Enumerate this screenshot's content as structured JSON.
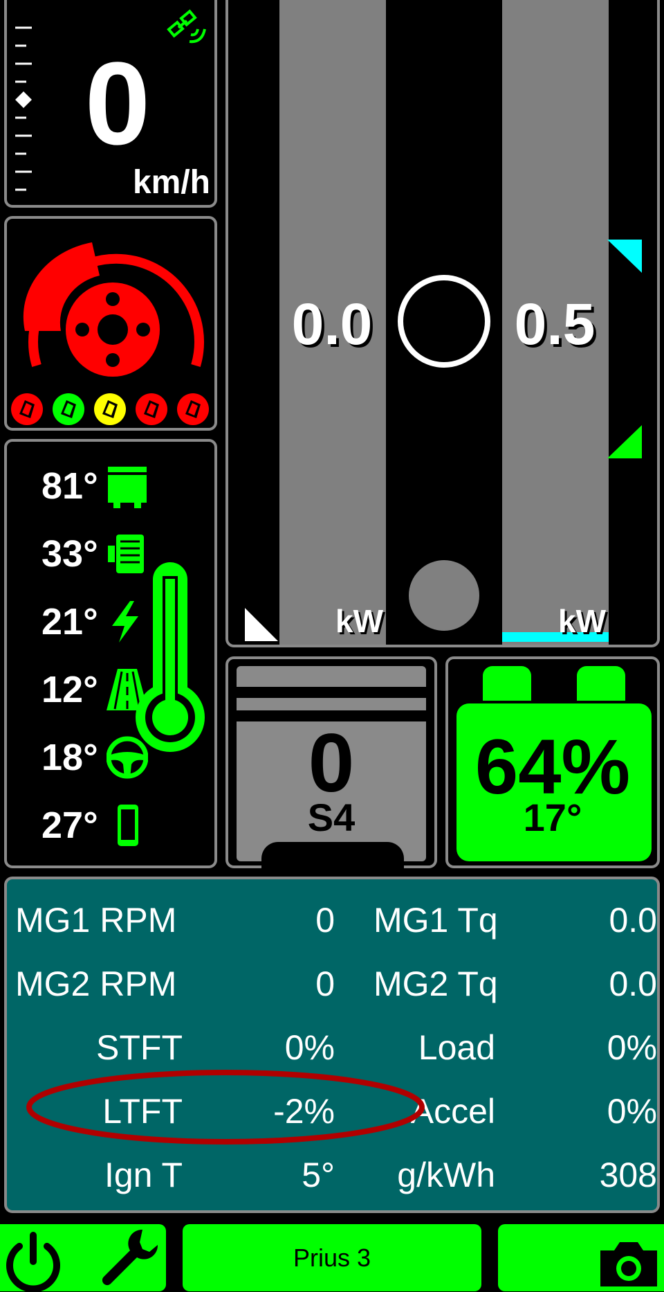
{
  "speed": {
    "value": "0",
    "unit": "km/h",
    "icon": "satellite-icon"
  },
  "power": {
    "left_value": "0.0",
    "right_value": "0.5",
    "left_unit": "kW",
    "right_unit": "kW"
  },
  "brake_indicator": {
    "pads": [
      "red",
      "green",
      "yellow",
      "red",
      "red"
    ]
  },
  "temperatures": [
    {
      "value": "81°",
      "icon": "engine-icon"
    },
    {
      "value": "33°",
      "icon": "radiator-icon"
    },
    {
      "value": "21°",
      "icon": "lightning-icon"
    },
    {
      "value": "12°",
      "icon": "road-icon"
    },
    {
      "value": "18°",
      "icon": "steering-wheel-icon"
    },
    {
      "value": "27°",
      "icon": "phone-icon"
    }
  ],
  "gear": {
    "value": "0",
    "mode": "S4"
  },
  "battery": {
    "percent": "64%",
    "temp": "17°"
  },
  "stats": [
    {
      "label": "MG1 RPM",
      "value": "0",
      "label2": "MG1 Tq",
      "value2": "0.0"
    },
    {
      "label": "MG2 RPM",
      "value": "0",
      "label2": "MG2 Tq",
      "value2": "0.0"
    },
    {
      "label": "STFT",
      "value": "0%",
      "label2": "Load",
      "value2": "0%"
    },
    {
      "label": "LTFT",
      "value": "-2%",
      "label2": "Accel",
      "value2": "0%"
    },
    {
      "label": "Ign T",
      "value": "5°",
      "label2": "g/kWh",
      "value2": "308"
    }
  ],
  "footer": {
    "profile_label": "Prius 3"
  },
  "colors": {
    "green": "#00ff00",
    "red": "#ff0000",
    "cyan": "#00ffff",
    "teal": "#006666",
    "yellow": "#ffff00"
  }
}
